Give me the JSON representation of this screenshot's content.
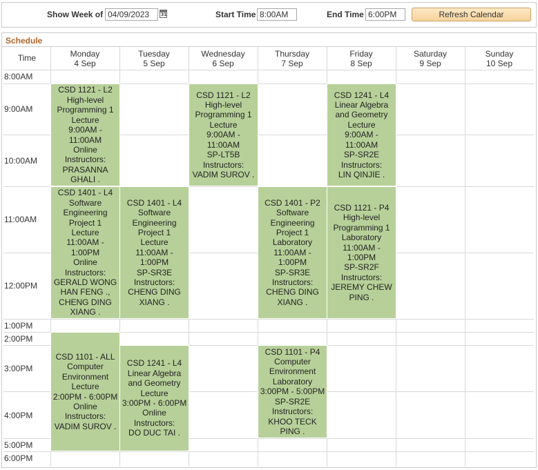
{
  "toolbar": {
    "show_week_label": "Show Week of",
    "show_week_value": "04/09/2023",
    "calendar_icon_text": "31",
    "start_time_label": "Start Time",
    "start_time_value": "8:00AM",
    "end_time_label": "End Time",
    "end_time_value": "6:00PM",
    "refresh_label": "Refresh Calendar"
  },
  "schedule": {
    "title": "Schedule",
    "time_header": "Time",
    "days": [
      {
        "name": "Monday",
        "date": "4 Sep"
      },
      {
        "name": "Tuesday",
        "date": "5 Sep"
      },
      {
        "name": "Wednesday",
        "date": "6 Sep"
      },
      {
        "name": "Thursday",
        "date": "7 Sep"
      },
      {
        "name": "Friday",
        "date": "8 Sep"
      },
      {
        "name": "Saturday",
        "date": "9 Sep"
      },
      {
        "name": "Sunday",
        "date": "10 Sep"
      }
    ],
    "times": [
      "8:00AM",
      "9:00AM",
      "10:00AM",
      "11:00AM",
      "12:00PM",
      "1:00PM",
      "2:00PM",
      "3:00PM",
      "4:00PM",
      "5:00PM",
      "6:00PM"
    ],
    "events": [
      {
        "id": "mon-csd1121-l2",
        "text": "CSD 1121 - L2\nHigh-level\nProgramming 1\nLecture\n9:00AM -\n11:00AM\nOnline\nInstructors:\nPRASANNA\nGHALI ."
      },
      {
        "id": "wed-csd1121-l2",
        "text": "CSD 1121 - L2\nHigh-level\nProgramming 1\nLecture\n9:00AM -\n11:00AM\nSP-LT5B\nInstructors:\nVADIM SUROV ."
      },
      {
        "id": "fri-csd1241-l4",
        "text": "CSD 1241 - L4\nLinear Algebra\nand Geometry\nLecture\n9:00AM -\n11:00AM\nSP-SR2E\nInstructors:\nLIN QINJIE ."
      },
      {
        "id": "mon-csd1401-l4",
        "text": "CSD 1401 - L4\nSoftware\nEngineering\nProject 1\nLecture\n11:00AM -\n1:00PM\nOnline\nInstructors:\nGERALD WONG\nHAN FENG .,\nCHENG DING\nXIANG ."
      },
      {
        "id": "tue-csd1401-l4",
        "text": "CSD 1401 - L4\nSoftware\nEngineering\nProject 1\nLecture\n11:00AM -\n1:00PM\nSP-SR3E\nInstructors:\nCHENG DING\nXIANG ."
      },
      {
        "id": "thu-csd1401-p2",
        "text": "CSD 1401 - P2\nSoftware\nEngineering\nProject 1\nLaboratory\n11:00AM -\n1:00PM\nSP-SR3E\nInstructors:\nCHENG DING\nXIANG ."
      },
      {
        "id": "fri-csd1121-p4",
        "text": "CSD 1121 - P4\nHigh-level\nProgramming 1\nLaboratory\n11:00AM -\n1:00PM\nSP-SR2F\nInstructors:\nJEREMY CHEW\nPING ."
      },
      {
        "id": "mon-csd1101-all",
        "text": "CSD 1101 - ALL\nComputer\nEnvironment\nLecture\n2:00PM - 6:00PM\nOnline\nInstructors:\nVADIM SUROV ."
      },
      {
        "id": "tue-csd1241-l4",
        "text": "CSD 1241 - L4\nLinear Algebra\nand Geometry\nLecture\n3:00PM - 6:00PM\nOnline\nInstructors:\nDO DUC TAI ."
      },
      {
        "id": "thu-csd1101-p4",
        "text": "CSD 1101 - P4\nComputer\nEnvironment\nLaboratory\n3:00PM - 5:00PM\nSP-SR2E\nInstructors:\nKHOO TECK\nPING ."
      }
    ]
  },
  "colors": {
    "event_bg": "#b7d099",
    "title_color": "#b0652a",
    "button_bg": "#f6d39b"
  }
}
